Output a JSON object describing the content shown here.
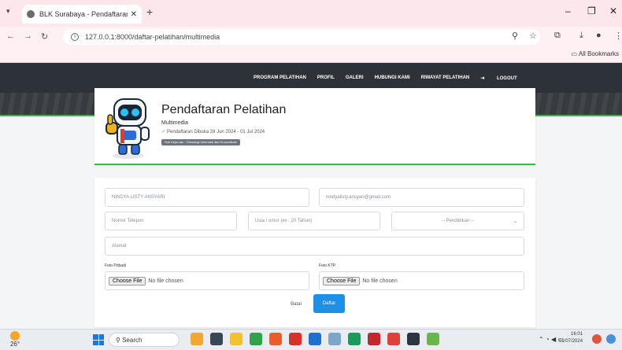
{
  "browser": {
    "tab_title": "BLK Surabaya - Pendaftaran Pel",
    "tab_close": "✕",
    "new_tab": "+",
    "url": "127.0.0.1:8000/daftar-pelatihan/multimedia",
    "bookmarks_label": "All Bookmarks",
    "window_controls": [
      "–",
      "❐",
      "✕"
    ]
  },
  "navbar": {
    "items": [
      "PROGRAM PELATIHAN",
      "PROFIL",
      "GALERI",
      "HUBUNGI KAMI",
      "RIWAYAT PELATIHAN",
      "LOGOUT"
    ],
    "logout_glyph": "⇥"
  },
  "header_card": {
    "title": "Pendaftaran Pelatihan",
    "program": "Multimedia",
    "date_text": "Pendaftaran Dibuka 28 Jun 2024 - 01 Jul 2024",
    "badge": "Sub Kejuruan : Teknologi Informasi dan Komunikasi"
  },
  "form": {
    "name_value": "NINDYA LISTY ANSYARI",
    "email_value": "nindyalisty.ansyari@gmail.com",
    "phone_placeholder": "Nomor Telepon",
    "age_placeholder": "Usia / umur (ex : 20 Tahun)",
    "education_select": "-- Pendidikan --",
    "address_placeholder": "Alamat",
    "foto_pribadi_label": "Foto Pribadi",
    "foto_ktp_label": "Foto KTP",
    "choose_file": "Choose File",
    "no_file": "No file chosen",
    "cancel_label": "Batal",
    "submit_label": "Daftar"
  },
  "taskbar": {
    "weather": "26°",
    "search_label": "Search",
    "time": "16:01",
    "date": "01/07/2024"
  },
  "colors": {
    "accent_green": "#3cb54a",
    "primary_blue": "#1e90e8",
    "navbar_dark": "#2d3238"
  }
}
